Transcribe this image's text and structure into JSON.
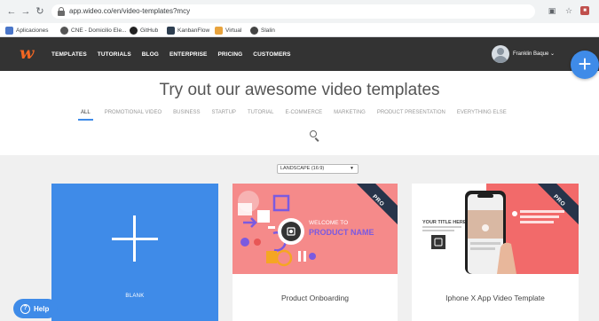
{
  "browser": {
    "url": "app.wideo.co/en/video-templates?mcy",
    "bookmarks": [
      {
        "label": "Aplicaciones",
        "color": "#4a76c9"
      },
      {
        "label": "CNE - Domicilio Ele...",
        "color": "#555555"
      },
      {
        "label": "GitHub",
        "color": "#222222"
      },
      {
        "label": "KanbanFlow",
        "color": "#2d3e50"
      },
      {
        "label": "Virtual",
        "color": "#e8a33d"
      },
      {
        "label": "Slalin",
        "color": "#444444"
      }
    ]
  },
  "header": {
    "logo": "w",
    "nav": [
      "TEMPLATES",
      "TUTORIALS",
      "BLOG",
      "ENTERPRISE",
      "PRICING",
      "CUSTOMERS"
    ],
    "user_name": "Franklin Baque ⌄",
    "fab_label": "+"
  },
  "page": {
    "title": "Try out our awesome video templates",
    "categories": [
      "ALL",
      "PROMOTIONAL VIDEO",
      "BUSINESS",
      "STARTUP",
      "TUTORIAL",
      "E-COMMERCE",
      "MARKETING",
      "PRODUCT PRESENTATION",
      "EVERYTHING ELSE"
    ],
    "format_select": "LANDSCAPE (16:9)"
  },
  "cards": [
    {
      "label": "BLANK"
    },
    {
      "title": "Product Onboarding",
      "badge": "PRO",
      "thumb_line1": "WELCOME TO",
      "thumb_line2": "PRODUCT NAME"
    },
    {
      "title": "Iphone X App Video Template",
      "badge": "PRO",
      "thumb_left": "YOUR TITLE HERE"
    }
  ],
  "help": {
    "label": "Help"
  },
  "colors": {
    "brand_orange": "#f26622",
    "accent_blue": "#3f8be8",
    "header_bg": "#333333",
    "pro_ribbon": "#27344a",
    "thumb_pink": "#f58a8a",
    "thumb_purple": "#7b5ae0"
  }
}
